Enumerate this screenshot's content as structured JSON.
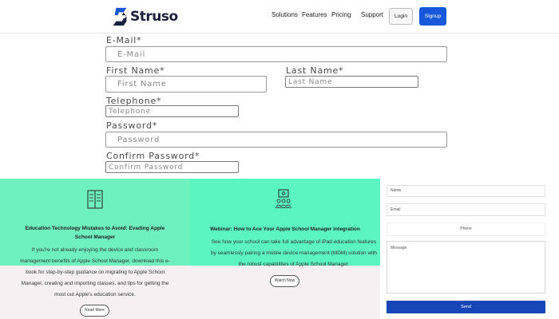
{
  "header": {
    "logo_text": "Struso",
    "nav": [
      "Solutions",
      "Features",
      "Pricing",
      "Support"
    ],
    "login_label": "Login",
    "signup_label": "Signup"
  },
  "form": {
    "email_label": "E-Mail*",
    "email_placeholder": "E-Mail",
    "first_name_label": "First Name*",
    "first_name_placeholder": "First Name",
    "last_name_label": "Last Name*",
    "last_name_placeholder": "Last Name",
    "telephone_label": "Telephone*",
    "telephone_placeholder": "Telephone",
    "password_label": "Password*",
    "password_placeholder": "Password",
    "confirm_password_label": "Confirm Password*",
    "confirm_password_placeholder": "Confirm Password"
  },
  "cards": [
    {
      "icon": "book-icon",
      "title": "Education Technology Mistakes to Avoid: Evading Apple School Manager",
      "description": "If you're not already enjoying the device and classroom management benefits of Apple School Manager, download this e-book for step-by-step guidance on migrating to Apple School Manager, creating and importing classes, and tips for getting the most out Apple's education service.",
      "button_label": "Read More"
    },
    {
      "icon": "presentation-icon",
      "title": "Webinar: How to Ace Your Apple School Manager integration",
      "description": "See how your school can take full advantage of iPad education features by seamlessly pairing a mobile device management (MDM) solution with the robust capabilities of Apple School Manager.",
      "button_label": "Watch Now"
    }
  ],
  "contact": {
    "name_placeholder": "Name",
    "email_placeholder": "Email",
    "phone_placeholder": "Phone",
    "message_placeholder": "Message",
    "send_label": "Send"
  },
  "colors": {
    "primary_button": "#1658d9",
    "send_button": "#1646b8",
    "card_a_bg": "#6ff0bf",
    "card_b_bg": "#5bf5c2"
  }
}
